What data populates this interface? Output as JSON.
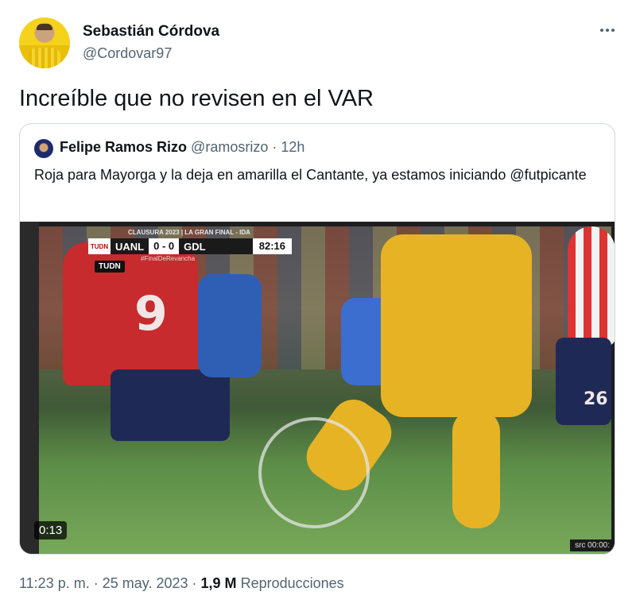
{
  "author": {
    "name": "Sebastián Córdova",
    "handle": "@Cordovar97"
  },
  "tweet": {
    "text": "Increíble que no revisen en el VAR"
  },
  "quote": {
    "name": "Felipe Ramos Rizo",
    "handle": "@ramosrizo",
    "separator": "·",
    "time": "12h",
    "text": "Roja para Mayorga y la deja en amarilla el Cantante, ya estamos iniciando @futpicante"
  },
  "video": {
    "duration": "0:13",
    "scoreboard": {
      "title": "CLAUSURA 2023 | LA GRAN FINAL - IDA",
      "logo": "TUDN",
      "home": "UANL",
      "score": "0 - 0",
      "away": "GDL",
      "clock": "82:16",
      "hashtag": "#FinalDeRevancha"
    },
    "channel_badge": "TUDN",
    "src_label": "src 00:00:",
    "jersey_left": "9",
    "jersey_right": "26"
  },
  "footer": {
    "time": "11:23 p. m.",
    "dot1": "·",
    "date": "25 may. 2023",
    "dot2": "·",
    "views_count": "1,9 M",
    "views_label": "Reproducciones"
  },
  "icons": {
    "more": "more-horizontal-icon"
  }
}
